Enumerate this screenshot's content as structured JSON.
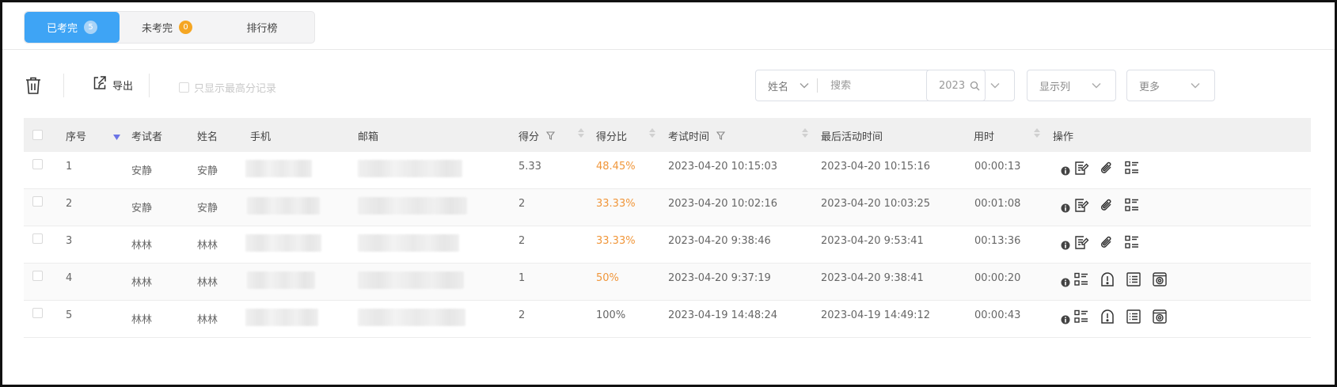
{
  "tabs": [
    {
      "label": "已考完",
      "badge": "5"
    },
    {
      "label": "未考完",
      "badge": "0"
    },
    {
      "label": "排行榜"
    }
  ],
  "toolbar": {
    "export_label": "导出",
    "only_max_label": "只显示最高分记录",
    "search_field": "姓名",
    "search_placeholder": "搜索",
    "year": "2023",
    "columns_label": "显示列",
    "more_label": "更多"
  },
  "table": {
    "headers": {
      "index": "序号",
      "examinee": "考试者",
      "name": "姓名",
      "phone": "手机",
      "email": "邮箱",
      "score": "得分",
      "ratio": "得分比",
      "exam_time": "考试时间",
      "last_active": "最后活动时间",
      "duration": "用时",
      "actions": "操作"
    },
    "rows": [
      {
        "index": "1",
        "examinee": "安静",
        "name": "安静",
        "score": "5.33",
        "ratio": "48.45%",
        "exam_time": "2023-04-20 10:15:03",
        "last_active": "2023-04-20 10:15:16",
        "duration": "00:00:13"
      },
      {
        "index": "2",
        "examinee": "安静",
        "name": "安静",
        "score": "2",
        "ratio": "33.33%",
        "exam_time": "2023-04-20 10:02:16",
        "last_active": "2023-04-20 10:03:25",
        "duration": "00:01:08"
      },
      {
        "index": "3",
        "examinee": "林林",
        "name": "林林",
        "score": "2",
        "ratio": "33.33%",
        "exam_time": "2023-04-20 9:38:46",
        "last_active": "2023-04-20 9:53:41",
        "duration": "00:13:36"
      },
      {
        "index": "4",
        "examinee": "林林",
        "name": "林林",
        "score": "1",
        "ratio": "50%",
        "exam_time": "2023-04-20 9:37:19",
        "last_active": "2023-04-20 9:38:41",
        "duration": "00:00:20"
      },
      {
        "index": "5",
        "examinee": "林林",
        "name": "林林",
        "score": "2",
        "ratio": "100%",
        "exam_time": "2023-04-19 14:48:24",
        "last_active": "2023-04-19 14:49:12",
        "duration": "00:00:43"
      }
    ]
  },
  "colors": {
    "accent": "#3ea4f5",
    "ratio_low": "#f0963a",
    "badge_pending": "#f5a623"
  }
}
